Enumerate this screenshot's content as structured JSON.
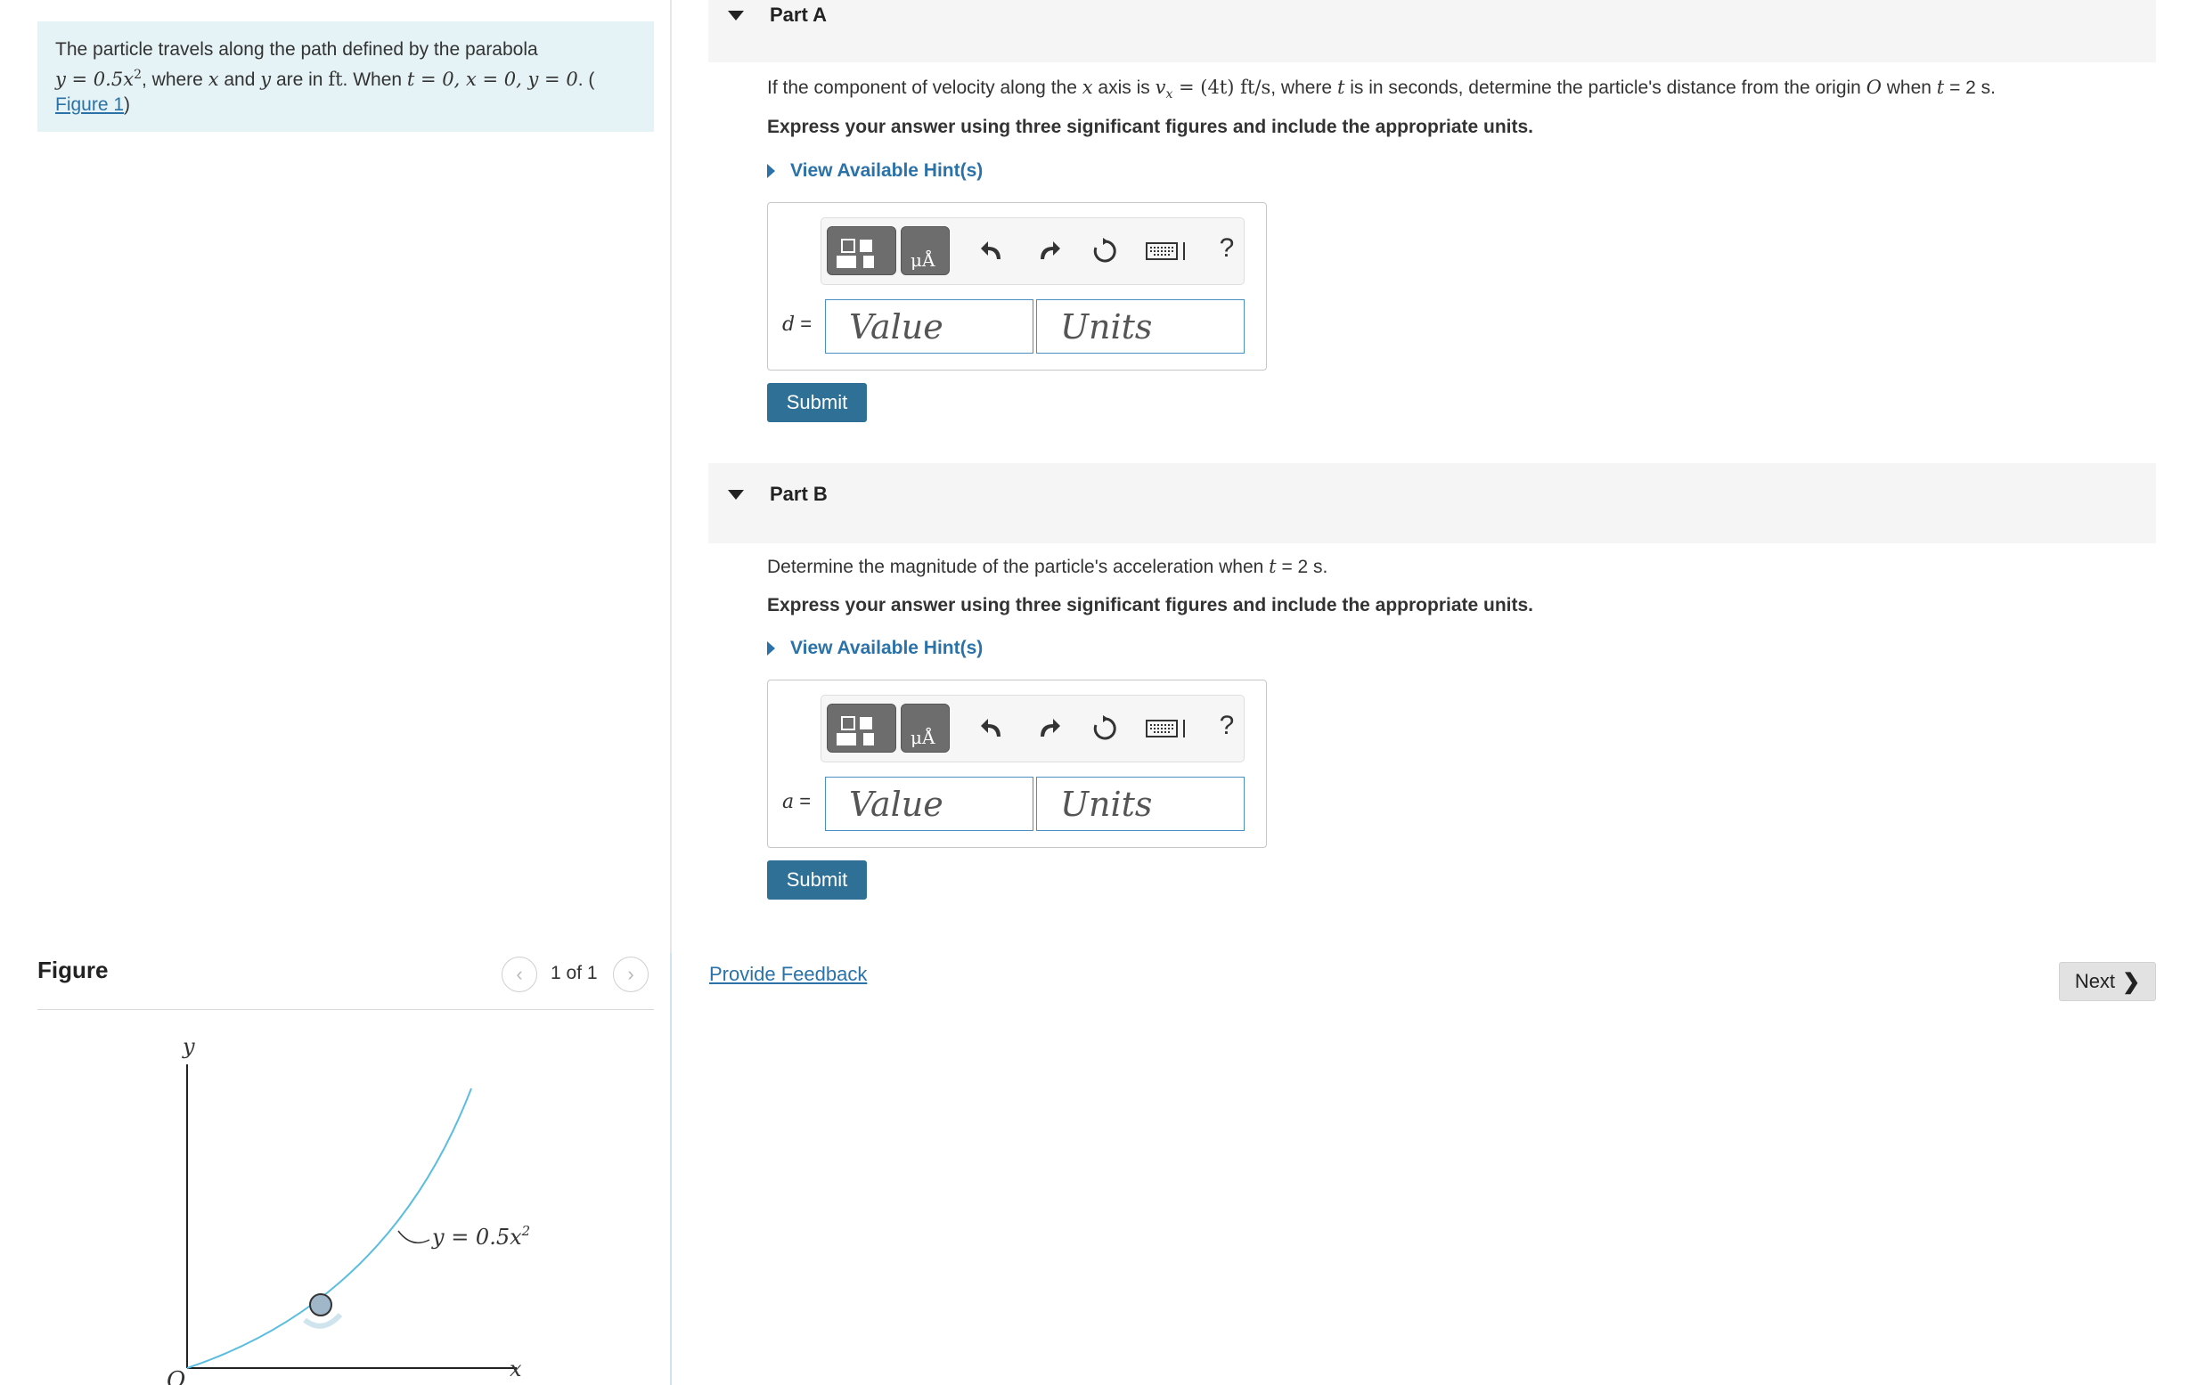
{
  "problem": {
    "line1": "The particle travels along the path defined by the parabola",
    "eq": "y = 0.5x",
    "eq_sup": "2",
    "where": ", where ",
    "x": "x",
    "and": " and ",
    "y": "y",
    "are_in": " are in ",
    "ft": "ft",
    "when": ". When ",
    "conditions": "t = 0, x = 0, y = 0",
    "paren_open": ". (",
    "figure_link": "Figure 1",
    "paren_close": ")"
  },
  "figure": {
    "title": "Figure",
    "pager_count": "1 of 1",
    "prev_glyph": "‹",
    "next_glyph": "›",
    "axis_y": "y",
    "axis_x": "x",
    "origin": "O",
    "curve_label": "y = 0.5x",
    "curve_label_sup": "2",
    "curve_color": "#5bbde0"
  },
  "partA": {
    "label": "Part A",
    "q_prefix": "If the component of velocity along the ",
    "q_x": "x",
    "q_axis_is": " axis is ",
    "q_vx": "v",
    "q_vx_sub": "x",
    "q_eq": " = (4t)  ft/s",
    "q_where": ", where ",
    "q_t": "t",
    "q_mid": " is in seconds, determine the particle's distance from the origin ",
    "q_O": "O",
    "q_when": " when ",
    "q_t2": "t",
    "q_end": " = 2 s.",
    "instruction": "Express your answer using three significant figures and include the appropriate units.",
    "hint": "View Available Hint(s)",
    "var": "d",
    "equals": " =",
    "value_placeholder": "Value",
    "units_placeholder": "Units",
    "help": "?",
    "submit": "Submit"
  },
  "partB": {
    "label": "Part B",
    "q_prefix": "Determine the magnitude of the particle's acceleration when ",
    "q_t": "t",
    "q_end": " = 2 s.",
    "instruction": "Express your answer using three significant figures and include the appropriate units.",
    "hint": "View Available Hint(s)",
    "var": "a",
    "equals": " =",
    "value_placeholder": "Value",
    "units_placeholder": "Units",
    "help": "?",
    "submit": "Submit"
  },
  "footer": {
    "feedback": "Provide Feedback",
    "next": "Next",
    "next_glyph": "❯"
  },
  "colors": {
    "link": "#2a72a8",
    "submit_bg": "#2f7096",
    "problem_bg": "#e5f3f6",
    "field_border": "#4a90c2"
  }
}
